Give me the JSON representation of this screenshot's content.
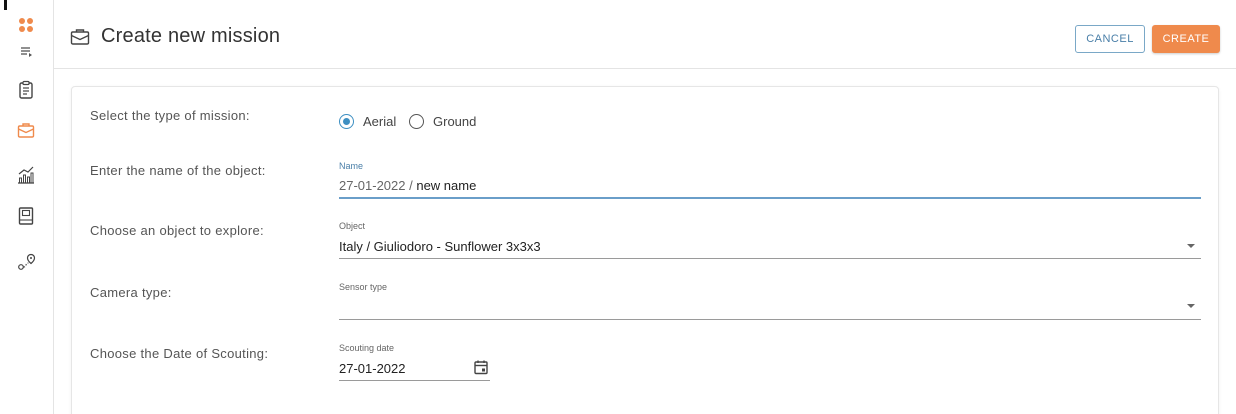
{
  "header": {
    "title": "Create new mission",
    "cancel_label": "CANCEL",
    "create_label": "CREATE"
  },
  "sidebar": {
    "items": [
      {
        "icon": "apps-grid-icon"
      },
      {
        "icon": "menu-expand-icon"
      },
      {
        "icon": "clipboard-icon"
      },
      {
        "icon": "mission-briefcase-icon",
        "active": true
      },
      {
        "icon": "analytics-chart-icon"
      },
      {
        "icon": "book-icon"
      },
      {
        "icon": "route-icon"
      }
    ]
  },
  "form": {
    "mission_type": {
      "label": "Select the type of mission:",
      "options": [
        "Aerial",
        "Ground"
      ],
      "selected": "Aerial"
    },
    "name": {
      "label": "Enter the name of the object:",
      "field_label": "Name",
      "prefix": "27-01-2022 / ",
      "value": "new name"
    },
    "object": {
      "label": "Choose an object to explore:",
      "field_label": "Object",
      "value": "Italy / Giuliodoro - Sunflower 3x3x3"
    },
    "camera": {
      "label": "Camera type:",
      "field_label": "Sensor type",
      "value": ""
    },
    "date": {
      "label": "Choose the Date of Scouting:",
      "field_label": "Scouting date",
      "value": "27-01-2022"
    }
  },
  "colors": {
    "accent": "#ef8a4c",
    "primary": "#3d8fc2",
    "border": "#e4e4e4"
  }
}
